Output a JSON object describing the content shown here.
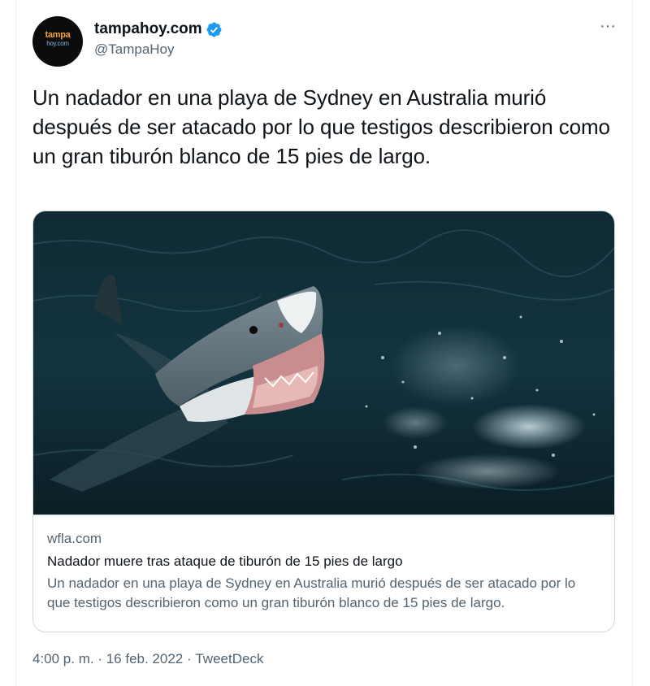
{
  "author": {
    "display_name": "tampahoy.com",
    "handle": "@TampaHoy",
    "avatar_text": "tampa",
    "avatar_subtext": "hoy.com",
    "verified": true
  },
  "icons": {
    "verified": "verified-badge-icon",
    "more": "more-options-icon"
  },
  "more_label": "···",
  "tweet": {
    "text": "Un nadador en una playa de Sydney en Australia murió después de ser atacado por lo que testigos describieron como un gran tiburón blanco de 15 pies de largo."
  },
  "card": {
    "domain": "wfla.com",
    "title": "Nadador muere tras ataque de tiburón de 15 pies de largo",
    "description": "Un nadador en una playa de Sydney en Australia murió después de ser atacado por lo que testigos describieron como un gran tiburón blanco de 15 pies de largo."
  },
  "meta": {
    "time": "4:00 p. m.",
    "separator": " · ",
    "date": "16 feb. 2022",
    "source": "TweetDeck"
  },
  "colors": {
    "verified_blue": "#1d9bf0",
    "text_primary": "#0f1419",
    "text_secondary": "#536471",
    "border": "#cfd9de"
  }
}
